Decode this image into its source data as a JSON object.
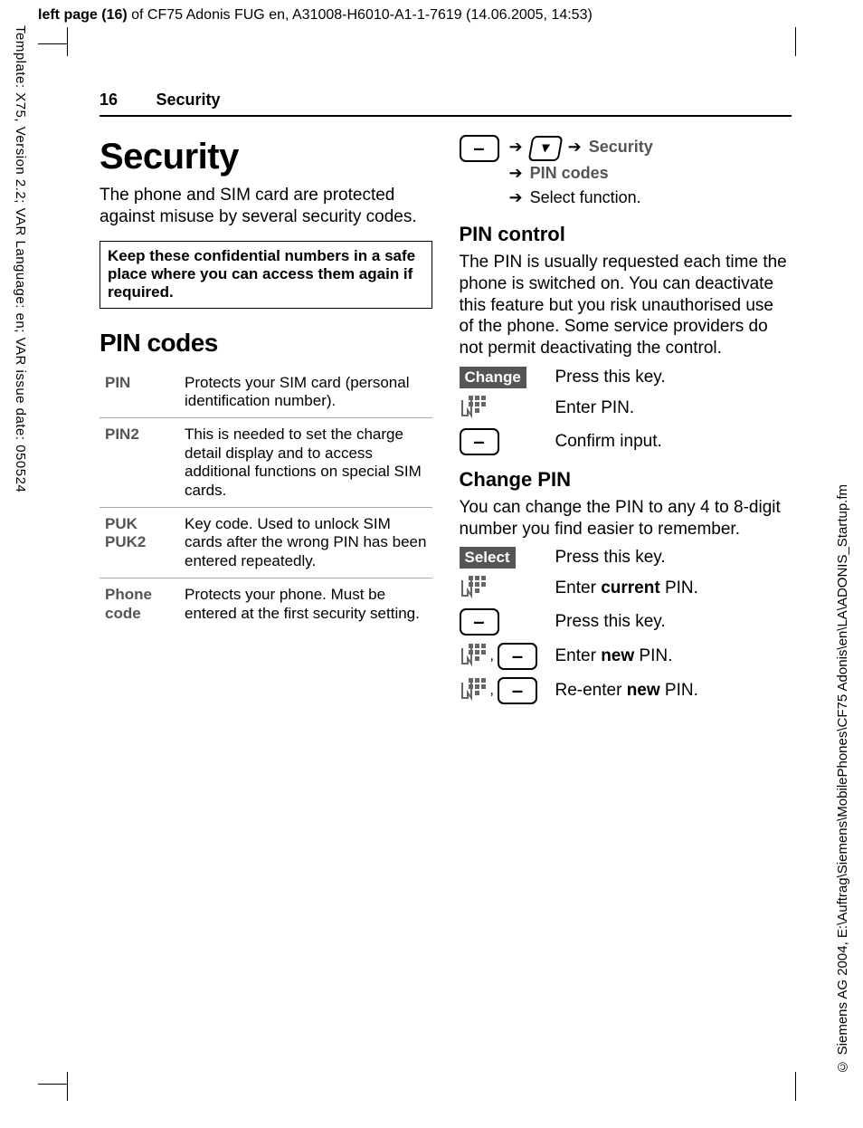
{
  "meta": {
    "top_header_prefix": "left page (16)",
    "top_header_rest": " of CF75 Adonis FUG en, A31008-H6010-A1-1-7619 (14.06.2005, 14:53)",
    "left_margin": "Template: X75, Version 2.2; VAR Language: en; VAR issue date: 050524",
    "right_margin": "© Siemens AG 2004, E:\\Auftrag\\Siemens\\MobilePhones\\CF75 Adonis\\en\\LA\\ADONIS_Startup.fm"
  },
  "header": {
    "page_number": "16",
    "section": "Security"
  },
  "left": {
    "title": "Security",
    "intro": "The phone and SIM card are protected against misuse by several security codes.",
    "note": "Keep these confidential numbers in a safe place where you can access them again if required.",
    "pin_codes_heading": "PIN codes",
    "codes": [
      {
        "term": "PIN",
        "def": "Protects your SIM card (personal identification number)."
      },
      {
        "term": "PIN2",
        "def": "This is needed to set the charge detail display and to access additional functions on special SIM cards."
      },
      {
        "term": "PUK\nPUK2",
        "def": "Key code. Used to unlock SIM cards after the wrong PIN has been entered repeatedly."
      },
      {
        "term": "Phone\ncode",
        "def": "Protects your phone. Must be entered at the first security setting."
      }
    ]
  },
  "right": {
    "nav": {
      "step1": "Security",
      "step2": "PIN codes",
      "step3": "Select function."
    },
    "pin_control": {
      "heading": "PIN control",
      "body": "The PIN is usually requested each time the phone is switched on. You can deactivate this feature but you risk unauthorised use of the phone. Some service providers do not permit deactivating the control.",
      "change_label": "Change",
      "step_press": "Press this key.",
      "step_enter": "Enter PIN.",
      "step_confirm": "Confirm input."
    },
    "change_pin": {
      "heading": "Change PIN",
      "body": "You can change the PIN to any 4 to 8-digit number you find easier to remember.",
      "select_label": "Select",
      "step_press": "Press this key.",
      "step_enter_current_pre": "Enter ",
      "step_enter_current_bold": "current",
      "step_enter_current_post": " PIN.",
      "step_press2": "Press this key.",
      "step_enter_new_pre": "Enter ",
      "step_enter_new_bold": "new",
      "step_enter_new_post": " PIN.",
      "step_reenter_pre": "Re-enter ",
      "step_reenter_bold": "new",
      "step_reenter_post": " PIN."
    }
  }
}
